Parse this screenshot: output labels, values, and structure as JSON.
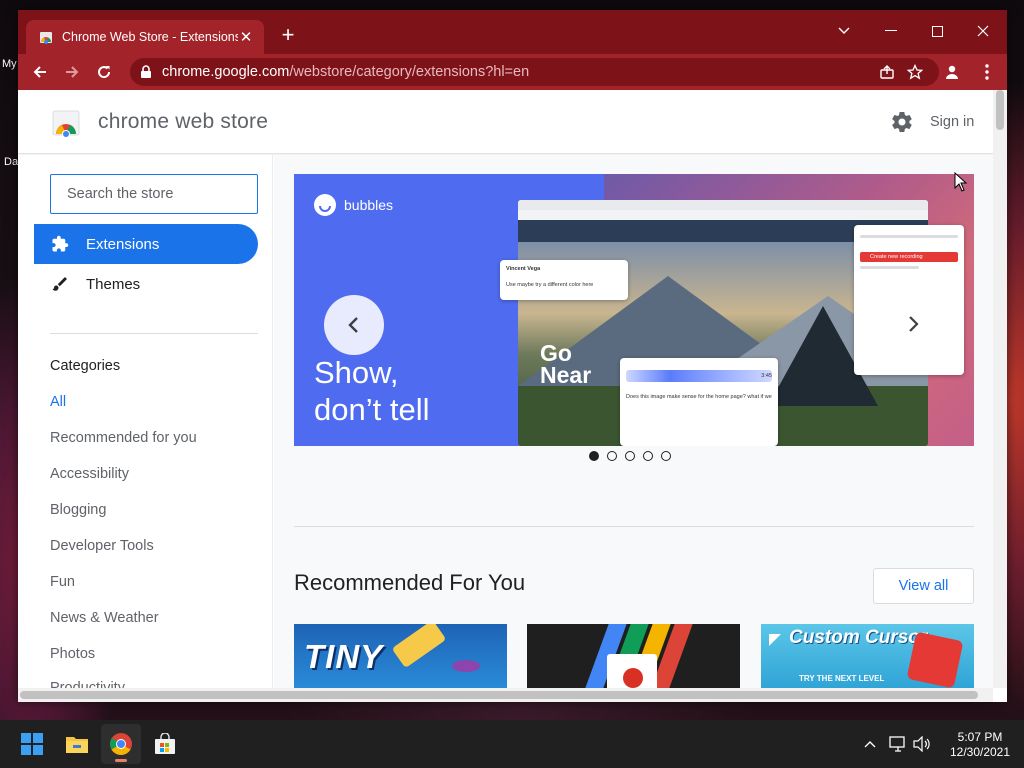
{
  "desktop": {
    "labels": [
      "My",
      "Da"
    ]
  },
  "browser": {
    "tab": {
      "title": "Chrome Web Store - Extensions",
      "close_glyph": "✕"
    },
    "new_tab_glyph": "+",
    "address": {
      "host": "chrome.google.com",
      "path": "/webstore/category/extensions?hl=en"
    }
  },
  "store": {
    "title": "chrome web store",
    "sign_in": "Sign in",
    "search": {
      "placeholder": "Search the store",
      "value": ""
    },
    "nav": [
      {
        "label": "Extensions",
        "icon": "puzzle-icon",
        "active": true
      },
      {
        "label": "Themes",
        "icon": "brush-icon",
        "active": false
      }
    ],
    "categories_heading": "Categories",
    "categories": [
      {
        "label": "All",
        "active": true
      },
      {
        "label": "Recommended for you"
      },
      {
        "label": "Accessibility"
      },
      {
        "label": "Blogging"
      },
      {
        "label": "Developer Tools"
      },
      {
        "label": "Fun"
      },
      {
        "label": "News & Weather"
      },
      {
        "label": "Photos"
      },
      {
        "label": "Productivity"
      }
    ],
    "hero": {
      "brand": "bubbles",
      "tagline_line1": "Show,",
      "tagline_line2": "don’t tell",
      "mock_headline_1": "Go",
      "mock_headline_2": "Near",
      "mock_user": "Vincent Vega",
      "mock_comment": "Use maybe try a different color here",
      "mock_question": "Does this image make sense for the home page? what if we",
      "mock_button": "Create new recording",
      "mock_time": "3:45",
      "active_slide": 1,
      "slide_count": 5
    },
    "recommended": {
      "heading": "Recommended For You",
      "view_all": "View all",
      "cards": [
        {
          "label": "TINY"
        },
        {
          "label": ""
        },
        {
          "label": "Custom Cursor",
          "sub": "TRY THE NEXT LEVEL"
        }
      ]
    }
  },
  "taskbar": {
    "time": "5:07 PM",
    "date": "12/30/2021"
  },
  "colors": {
    "titlebar": "#7d1319",
    "toolbar": "#a3232a",
    "accent": "#1a73e8",
    "hero_blue": "#4f6cf0"
  }
}
